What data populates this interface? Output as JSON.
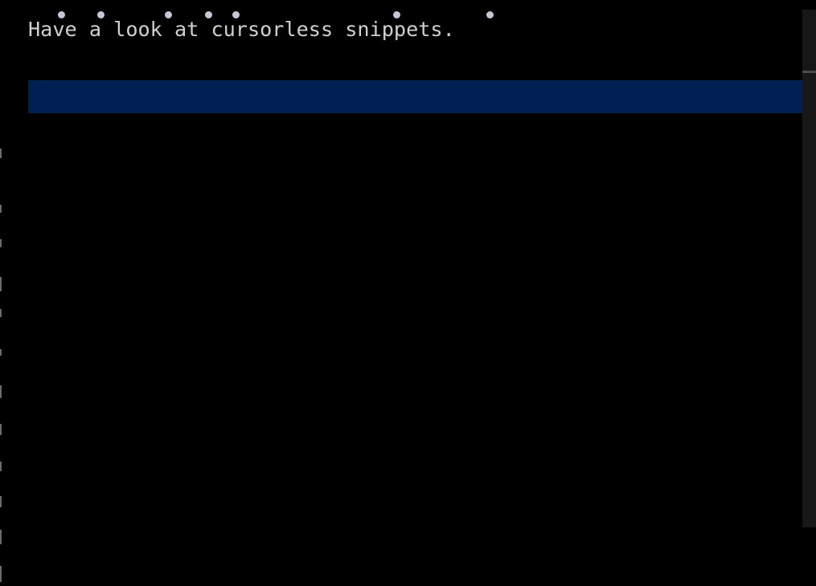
{
  "editor": {
    "code_line": "Have a look at cursorless snippets.",
    "hat_marks": [
      "H",
      "a",
      "l",
      "a",
      "c",
      "s",
      "."
    ]
  },
  "colors": {
    "background": "#000000",
    "text": "#d0d0d0",
    "hat": "#c6c6d8",
    "selection": "#001f52",
    "scrollbar": "#171717"
  }
}
